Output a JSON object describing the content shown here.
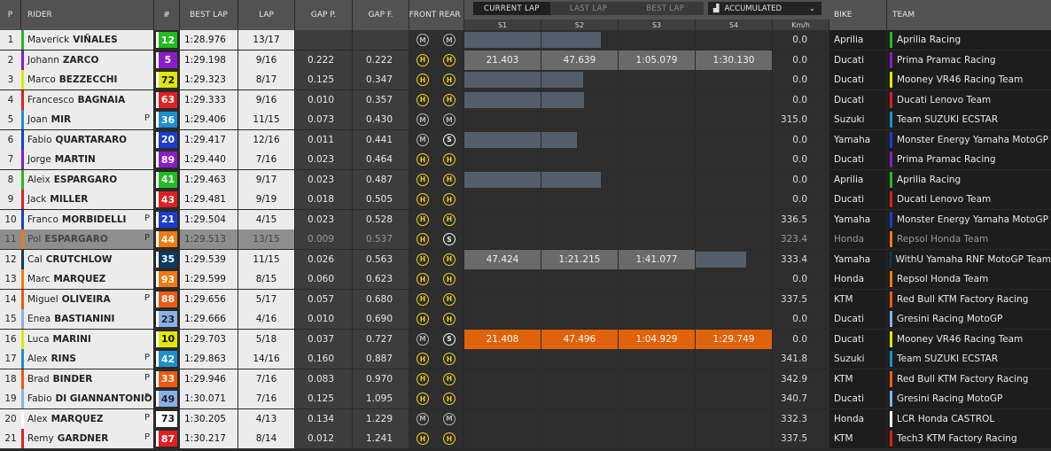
{
  "header": {
    "p": "P",
    "rider": "RIDER",
    "num": "#",
    "best_lap": "BEST LAP",
    "lap": "LAP",
    "gap_p": "GAP P.",
    "gap_f": "GAP F.",
    "front": "FRONT",
    "rear": "REAR",
    "tabs": [
      "CURRENT LAP",
      "LAST LAP",
      "BEST LAP"
    ],
    "active_tab": "CURRENT LAP",
    "mode": "ACCUMULATED",
    "sectors": [
      "S1",
      "S2",
      "S3",
      "S4"
    ],
    "kmh": "Km/h",
    "bike": "BIKE",
    "team": "TEAM"
  },
  "colors": {
    "aprilia": "#22bb22",
    "pramac": "#8a1cc8",
    "vr46": "#e0e800",
    "ducati": "#e02020",
    "suzuki": "#1d8fd0",
    "yamaha": "#1a3cd0",
    "repsol": "#f07a10",
    "ktm": "#f05a10",
    "gresini": "#8ab0e8",
    "lcr": "#ffffff",
    "tech3": "#e02020",
    "rnf": "#0a3a60",
    "sector_highlight": "#e0620a"
  },
  "rows": [
    {
      "pos": "1",
      "first": "Maverick",
      "last": "VIÑALES",
      "pit": "",
      "num": "12",
      "num_color": "#22bb22",
      "num_text": "#ffffff",
      "best": "1:28.976",
      "lap": "13/17",
      "gap_p": "",
      "gap_f": "",
      "front": "M",
      "rear": "M",
      "s1": "",
      "s2": "",
      "s3": "",
      "s4": "",
      "bar1": 1,
      "bar2": 0.78,
      "bar3": 0,
      "bar4": 0,
      "kmh": "0.0",
      "bike": "Aprilia",
      "team": "Aprilia Racing",
      "team_color": "#22bb22"
    },
    {
      "pos": "2",
      "first": "Johann",
      "last": "ZARCO",
      "pit": "",
      "num": "5",
      "num_color": "#8a1cc8",
      "num_text": "#ffffff",
      "best": "1:29.198",
      "lap": "9/16",
      "gap_p": "0.222",
      "gap_f": "0.222",
      "front": "H",
      "rear": "H",
      "s1": "21.403",
      "s2": "47.639",
      "s3": "1:05.079",
      "s4": "1:30.130",
      "bar1": 0,
      "bar2": 0,
      "bar3": 0,
      "bar4": 0,
      "full": true,
      "kmh": "0.0",
      "bike": "Ducati",
      "team": "Prima Pramac Racing",
      "team_color": "#8a1cc8"
    },
    {
      "pos": "3",
      "first": "Marco",
      "last": "BEZZECCHI",
      "pit": "",
      "num": "72",
      "num_color": "#e0e800",
      "num_text": "#111111",
      "best": "1:29.323",
      "lap": "8/17",
      "gap_p": "0.125",
      "gap_f": "0.347",
      "front": "H",
      "rear": "H",
      "s1": "",
      "s2": "",
      "s3": "",
      "s4": "",
      "bar1": 1,
      "bar2": 0.55,
      "bar3": 0,
      "bar4": 0,
      "kmh": "0.0",
      "bike": "Ducati",
      "team": "Mooney VR46 Racing Team",
      "team_color": "#e0e800"
    },
    {
      "pos": "4",
      "first": "Francesco",
      "last": "BAGNAIA",
      "pit": "",
      "num": "63",
      "num_color": "#e02020",
      "num_text": "#ffffff",
      "best": "1:29.333",
      "lap": "9/16",
      "gap_p": "0.010",
      "gap_f": "0.357",
      "front": "H",
      "rear": "H",
      "s1": "",
      "s2": "",
      "s3": "",
      "s4": "",
      "bar1": 1,
      "bar2": 0.56,
      "bar3": 0,
      "bar4": 0,
      "kmh": "0.0",
      "bike": "Ducati",
      "team": "Ducati Lenovo Team",
      "team_color": "#e02020"
    },
    {
      "pos": "5",
      "first": "Joan",
      "last": "MIR",
      "pit": "P",
      "num": "36",
      "num_color": "#1d8fd0",
      "num_text": "#ffffff",
      "best": "1:29.406",
      "lap": "11/15",
      "gap_p": "0.073",
      "gap_f": "0.430",
      "front": "M",
      "rear": "M",
      "s1": "",
      "s2": "",
      "s3": "",
      "s4": "",
      "bar1": 0,
      "bar2": 0,
      "bar3": 0,
      "bar4": 0,
      "kmh": "315.0",
      "bike": "Suzuki",
      "team": "Team SUZUKI ECSTAR",
      "team_color": "#1d8fd0"
    },
    {
      "pos": "6",
      "first": "Fabio",
      "last": "QUARTARARO",
      "pit": "",
      "num": "20",
      "num_color": "#1a3cd0",
      "num_text": "#ffffff",
      "best": "1:29.417",
      "lap": "12/16",
      "gap_p": "0.011",
      "gap_f": "0.441",
      "front": "M",
      "rear": "S",
      "s1": "",
      "s2": "",
      "s3": "",
      "s4": "",
      "bar1": 1,
      "bar2": 0.47,
      "bar3": 0,
      "bar4": 0,
      "kmh": "0.0",
      "bike": "Yamaha",
      "team": "Monster Energy Yamaha MotoGP",
      "team_color": "#1a3cd0"
    },
    {
      "pos": "7",
      "first": "Jorge",
      "last": "MARTIN",
      "pit": "",
      "num": "89",
      "num_color": "#8a1cc8",
      "num_text": "#ffffff",
      "best": "1:29.440",
      "lap": "7/16",
      "gap_p": "0.023",
      "gap_f": "0.464",
      "front": "H",
      "rear": "H",
      "s1": "",
      "s2": "",
      "s3": "",
      "s4": "",
      "bar1": 0,
      "bar2": 0,
      "bar3": 0,
      "bar4": 0,
      "kmh": "0.0",
      "bike": "Ducati",
      "team": "Prima Pramac Racing",
      "team_color": "#8a1cc8"
    },
    {
      "pos": "8",
      "first": "Aleix",
      "last": "ESPARGARO",
      "pit": "",
      "num": "41",
      "num_color": "#22bb22",
      "num_text": "#ffffff",
      "best": "1:29.463",
      "lap": "9/17",
      "gap_p": "0.023",
      "gap_f": "0.487",
      "front": "H",
      "rear": "H",
      "s1": "",
      "s2": "",
      "s3": "",
      "s4": "",
      "bar1": 1,
      "bar2": 0.78,
      "bar3": 0,
      "bar4": 0,
      "kmh": "0.0",
      "bike": "Aprilia",
      "team": "Aprilia Racing",
      "team_color": "#22bb22"
    },
    {
      "pos": "9",
      "first": "Jack",
      "last": "MILLER",
      "pit": "",
      "num": "43",
      "num_color": "#e02020",
      "num_text": "#ffffff",
      "best": "1:29.481",
      "lap": "9/19",
      "gap_p": "0.018",
      "gap_f": "0.505",
      "front": "H",
      "rear": "H",
      "s1": "",
      "s2": "",
      "s3": "",
      "s4": "",
      "bar1": 0,
      "bar2": 0,
      "bar3": 0,
      "bar4": 0,
      "kmh": "0.0",
      "bike": "Ducati",
      "team": "Ducati Lenovo Team",
      "team_color": "#e02020"
    },
    {
      "pos": "10",
      "first": "Franco",
      "last": "MORBIDELLI",
      "pit": "P",
      "num": "21",
      "num_color": "#1a3cd0",
      "num_text": "#ffffff",
      "best": "1:29.504",
      "lap": "4/15",
      "gap_p": "0.023",
      "gap_f": "0.528",
      "front": "H",
      "rear": "H",
      "s1": "",
      "s2": "",
      "s3": "",
      "s4": "",
      "bar1": 0,
      "bar2": 0,
      "bar3": 0,
      "bar4": 0,
      "kmh": "336.5",
      "bike": "Yamaha",
      "team": "Monster Energy Yamaha MotoGP",
      "team_color": "#1a3cd0"
    },
    {
      "pos": "11",
      "first": "Pol",
      "last": "ESPARGARO",
      "pit": "P",
      "num": "44",
      "num_color": "#f07a10",
      "num_text": "#ffffff",
      "best": "1:29.513",
      "lap": "13/15",
      "gap_p": "0.009",
      "gap_f": "0.537",
      "front": "H",
      "rear": "S",
      "s1": "",
      "s2": "",
      "s3": "",
      "s4": "",
      "bar1": 0,
      "bar2": 0,
      "bar3": 0,
      "bar4": 0,
      "dim": true,
      "kmh": "323.4",
      "bike": "Honda",
      "team": "Repsol Honda Team",
      "team_color": "#f07a10"
    },
    {
      "pos": "12",
      "first": "Cal",
      "last": "CRUTCHLOW",
      "pit": "",
      "num": "35",
      "num_color": "#0a3a60",
      "num_text": "#ffffff",
      "best": "1:29.539",
      "lap": "11/15",
      "gap_p": "0.026",
      "gap_f": "0.563",
      "front": "H",
      "rear": "H",
      "s1": "47.424",
      "s2": "1:21.215",
      "s3": "1:41.077",
      "s4": "",
      "bar1": 0,
      "bar2": 0,
      "bar3": 0,
      "bar4": 0.66,
      "full3": true,
      "kmh": "333.4",
      "bike": "Yamaha",
      "team": "WithU Yamaha RNF MotoGP Team",
      "team_color": "#0a3a60"
    },
    {
      "pos": "13",
      "first": "Marc",
      "last": "MARQUEZ",
      "pit": "",
      "num": "93",
      "num_color": "#f07a10",
      "num_text": "#ffffff",
      "best": "1:29.599",
      "lap": "8/15",
      "gap_p": "0.060",
      "gap_f": "0.623",
      "front": "H",
      "rear": "H",
      "s1": "",
      "s2": "",
      "s3": "",
      "s4": "",
      "bar1": 0,
      "bar2": 0,
      "bar3": 0,
      "bar4": 0,
      "kmh": "0.0",
      "bike": "Honda",
      "team": "Repsol Honda Team",
      "team_color": "#f07a10"
    },
    {
      "pos": "14",
      "first": "Miguel",
      "last": "OLIVEIRA",
      "pit": "P",
      "num": "88",
      "num_color": "#f05a10",
      "num_text": "#ffffff",
      "best": "1:29.656",
      "lap": "5/17",
      "gap_p": "0.057",
      "gap_f": "0.680",
      "front": "H",
      "rear": "H",
      "s1": "",
      "s2": "",
      "s3": "",
      "s4": "",
      "bar1": 0,
      "bar2": 0,
      "bar3": 0,
      "bar4": 0,
      "kmh": "337.5",
      "bike": "KTM",
      "team": "Red Bull KTM Factory Racing",
      "team_color": "#f05a10"
    },
    {
      "pos": "15",
      "first": "Enea",
      "last": "BASTIANINI",
      "pit": "",
      "num": "23",
      "num_color": "#8ab0e8",
      "num_text": "#222222",
      "best": "1:29.666",
      "lap": "4/16",
      "gap_p": "0.010",
      "gap_f": "0.690",
      "front": "H",
      "rear": "H",
      "s1": "",
      "s2": "",
      "s3": "",
      "s4": "",
      "bar1": 0,
      "bar2": 0,
      "bar3": 0,
      "bar4": 0,
      "kmh": "0.0",
      "bike": "Ducati",
      "team": "Gresini Racing MotoGP",
      "team_color": "#8ab0e8"
    },
    {
      "pos": "16",
      "first": "Luca",
      "last": "MARINI",
      "pit": "",
      "num": "10",
      "num_color": "#e0e800",
      "num_text": "#111111",
      "best": "1:29.703",
      "lap": "5/18",
      "gap_p": "0.037",
      "gap_f": "0.727",
      "front": "M",
      "rear": "S",
      "s1": "21.408",
      "s2": "47.496",
      "s3": "1:04.929",
      "s4": "1:29.749",
      "bar1": 0,
      "bar2": 0,
      "bar3": 0,
      "bar4": 0,
      "orange": true,
      "kmh": "0.0",
      "bike": "Ducati",
      "team": "Mooney VR46 Racing Team",
      "team_color": "#e0e800"
    },
    {
      "pos": "17",
      "first": "Alex",
      "last": "RINS",
      "pit": "P",
      "num": "42",
      "num_color": "#1d8fd0",
      "num_text": "#ffffff",
      "best": "1:29.863",
      "lap": "14/16",
      "gap_p": "0.160",
      "gap_f": "0.887",
      "front": "H",
      "rear": "H",
      "s1": "",
      "s2": "",
      "s3": "",
      "s4": "",
      "bar1": 0,
      "bar2": 0,
      "bar3": 0,
      "bar4": 0,
      "kmh": "341.8",
      "bike": "Suzuki",
      "team": "Team SUZUKI ECSTAR",
      "team_color": "#1d8fd0"
    },
    {
      "pos": "18",
      "first": "Brad",
      "last": "BINDER",
      "pit": "P",
      "num": "33",
      "num_color": "#f05a10",
      "num_text": "#ffffff",
      "best": "1:29.946",
      "lap": "7/16",
      "gap_p": "0.083",
      "gap_f": "0.970",
      "front": "H",
      "rear": "H",
      "s1": "",
      "s2": "",
      "s3": "",
      "s4": "",
      "bar1": 0,
      "bar2": 0,
      "bar3": 0,
      "bar4": 0,
      "kmh": "342.9",
      "bike": "KTM",
      "team": "Red Bull KTM Factory Racing",
      "team_color": "#f05a10"
    },
    {
      "pos": "19",
      "first": "Fabio",
      "last": "DI GIANNANTONIO",
      "pit": "P",
      "num": "49",
      "num_color": "#8ab0e8",
      "num_text": "#222222",
      "best": "1:30.071",
      "lap": "7/16",
      "gap_p": "0.125",
      "gap_f": "1.095",
      "front": "H",
      "rear": "H",
      "s1": "",
      "s2": "",
      "s3": "",
      "s4": "",
      "bar1": 0,
      "bar2": 0,
      "bar3": 0,
      "bar4": 0,
      "kmh": "340.7",
      "bike": "Ducati",
      "team": "Gresini Racing MotoGP",
      "team_color": "#8ab0e8"
    },
    {
      "pos": "20",
      "first": "Alex",
      "last": "MARQUEZ",
      "pit": "P",
      "num": "73",
      "num_color": "#ffffff",
      "num_text": "#111111",
      "best": "1:30.205",
      "lap": "4/13",
      "gap_p": "0.134",
      "gap_f": "1.229",
      "front": "M",
      "rear": "M",
      "s1": "",
      "s2": "",
      "s3": "",
      "s4": "",
      "bar1": 0,
      "bar2": 0,
      "bar3": 0,
      "bar4": 0,
      "kmh": "332.3",
      "bike": "Honda",
      "team": "LCR Honda CASTROL",
      "team_color": "#ffffff"
    },
    {
      "pos": "21",
      "first": "Remy",
      "last": "GARDNER",
      "pit": "P",
      "num": "87",
      "num_color": "#e02020",
      "num_text": "#ffffff",
      "best": "1:30.217",
      "lap": "8/14",
      "gap_p": "0.012",
      "gap_f": "1.241",
      "front": "H",
      "rear": "H",
      "s1": "",
      "s2": "",
      "s3": "",
      "s4": "",
      "bar1": 0,
      "bar2": 0,
      "bar3": 0,
      "bar4": 0,
      "kmh": "337.5",
      "bike": "KTM",
      "team": "Tech3 KTM Factory Racing",
      "team_color": "#e02020"
    }
  ]
}
